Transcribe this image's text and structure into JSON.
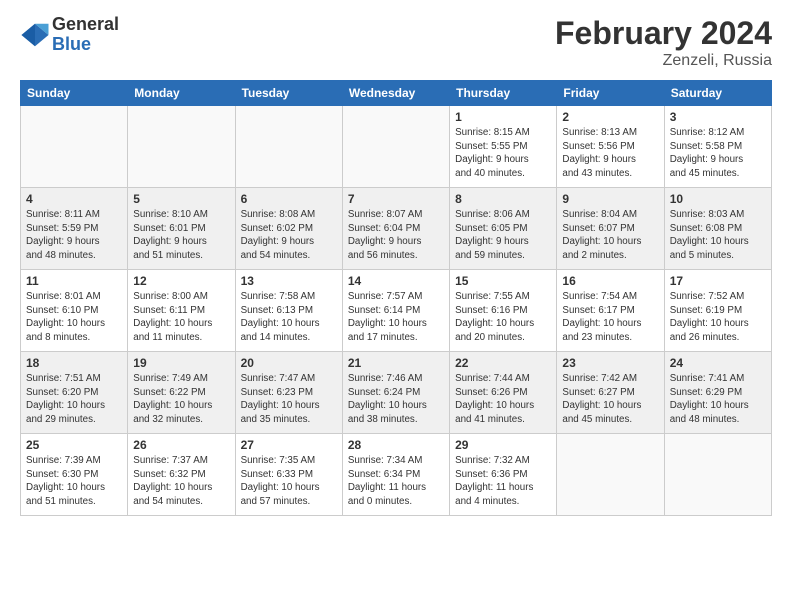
{
  "logo": {
    "general": "General",
    "blue": "Blue"
  },
  "title": {
    "month_year": "February 2024",
    "location": "Zenzeli, Russia"
  },
  "days_of_week": [
    "Sunday",
    "Monday",
    "Tuesday",
    "Wednesday",
    "Thursday",
    "Friday",
    "Saturday"
  ],
  "weeks": [
    {
      "shaded": false,
      "days": [
        {
          "number": "",
          "info": ""
        },
        {
          "number": "",
          "info": ""
        },
        {
          "number": "",
          "info": ""
        },
        {
          "number": "",
          "info": ""
        },
        {
          "number": "1",
          "info": "Sunrise: 8:15 AM\nSunset: 5:55 PM\nDaylight: 9 hours\nand 40 minutes."
        },
        {
          "number": "2",
          "info": "Sunrise: 8:13 AM\nSunset: 5:56 PM\nDaylight: 9 hours\nand 43 minutes."
        },
        {
          "number": "3",
          "info": "Sunrise: 8:12 AM\nSunset: 5:58 PM\nDaylight: 9 hours\nand 45 minutes."
        }
      ]
    },
    {
      "shaded": true,
      "days": [
        {
          "number": "4",
          "info": "Sunrise: 8:11 AM\nSunset: 5:59 PM\nDaylight: 9 hours\nand 48 minutes."
        },
        {
          "number": "5",
          "info": "Sunrise: 8:10 AM\nSunset: 6:01 PM\nDaylight: 9 hours\nand 51 minutes."
        },
        {
          "number": "6",
          "info": "Sunrise: 8:08 AM\nSunset: 6:02 PM\nDaylight: 9 hours\nand 54 minutes."
        },
        {
          "number": "7",
          "info": "Sunrise: 8:07 AM\nSunset: 6:04 PM\nDaylight: 9 hours\nand 56 minutes."
        },
        {
          "number": "8",
          "info": "Sunrise: 8:06 AM\nSunset: 6:05 PM\nDaylight: 9 hours\nand 59 minutes."
        },
        {
          "number": "9",
          "info": "Sunrise: 8:04 AM\nSunset: 6:07 PM\nDaylight: 10 hours\nand 2 minutes."
        },
        {
          "number": "10",
          "info": "Sunrise: 8:03 AM\nSunset: 6:08 PM\nDaylight: 10 hours\nand 5 minutes."
        }
      ]
    },
    {
      "shaded": false,
      "days": [
        {
          "number": "11",
          "info": "Sunrise: 8:01 AM\nSunset: 6:10 PM\nDaylight: 10 hours\nand 8 minutes."
        },
        {
          "number": "12",
          "info": "Sunrise: 8:00 AM\nSunset: 6:11 PM\nDaylight: 10 hours\nand 11 minutes."
        },
        {
          "number": "13",
          "info": "Sunrise: 7:58 AM\nSunset: 6:13 PM\nDaylight: 10 hours\nand 14 minutes."
        },
        {
          "number": "14",
          "info": "Sunrise: 7:57 AM\nSunset: 6:14 PM\nDaylight: 10 hours\nand 17 minutes."
        },
        {
          "number": "15",
          "info": "Sunrise: 7:55 AM\nSunset: 6:16 PM\nDaylight: 10 hours\nand 20 minutes."
        },
        {
          "number": "16",
          "info": "Sunrise: 7:54 AM\nSunset: 6:17 PM\nDaylight: 10 hours\nand 23 minutes."
        },
        {
          "number": "17",
          "info": "Sunrise: 7:52 AM\nSunset: 6:19 PM\nDaylight: 10 hours\nand 26 minutes."
        }
      ]
    },
    {
      "shaded": true,
      "days": [
        {
          "number": "18",
          "info": "Sunrise: 7:51 AM\nSunset: 6:20 PM\nDaylight: 10 hours\nand 29 minutes."
        },
        {
          "number": "19",
          "info": "Sunrise: 7:49 AM\nSunset: 6:22 PM\nDaylight: 10 hours\nand 32 minutes."
        },
        {
          "number": "20",
          "info": "Sunrise: 7:47 AM\nSunset: 6:23 PM\nDaylight: 10 hours\nand 35 minutes."
        },
        {
          "number": "21",
          "info": "Sunrise: 7:46 AM\nSunset: 6:24 PM\nDaylight: 10 hours\nand 38 minutes."
        },
        {
          "number": "22",
          "info": "Sunrise: 7:44 AM\nSunset: 6:26 PM\nDaylight: 10 hours\nand 41 minutes."
        },
        {
          "number": "23",
          "info": "Sunrise: 7:42 AM\nSunset: 6:27 PM\nDaylight: 10 hours\nand 45 minutes."
        },
        {
          "number": "24",
          "info": "Sunrise: 7:41 AM\nSunset: 6:29 PM\nDaylight: 10 hours\nand 48 minutes."
        }
      ]
    },
    {
      "shaded": false,
      "days": [
        {
          "number": "25",
          "info": "Sunrise: 7:39 AM\nSunset: 6:30 PM\nDaylight: 10 hours\nand 51 minutes."
        },
        {
          "number": "26",
          "info": "Sunrise: 7:37 AM\nSunset: 6:32 PM\nDaylight: 10 hours\nand 54 minutes."
        },
        {
          "number": "27",
          "info": "Sunrise: 7:35 AM\nSunset: 6:33 PM\nDaylight: 10 hours\nand 57 minutes."
        },
        {
          "number": "28",
          "info": "Sunrise: 7:34 AM\nSunset: 6:34 PM\nDaylight: 11 hours\nand 0 minutes."
        },
        {
          "number": "29",
          "info": "Sunrise: 7:32 AM\nSunset: 6:36 PM\nDaylight: 11 hours\nand 4 minutes."
        },
        {
          "number": "",
          "info": ""
        },
        {
          "number": "",
          "info": ""
        }
      ]
    }
  ]
}
